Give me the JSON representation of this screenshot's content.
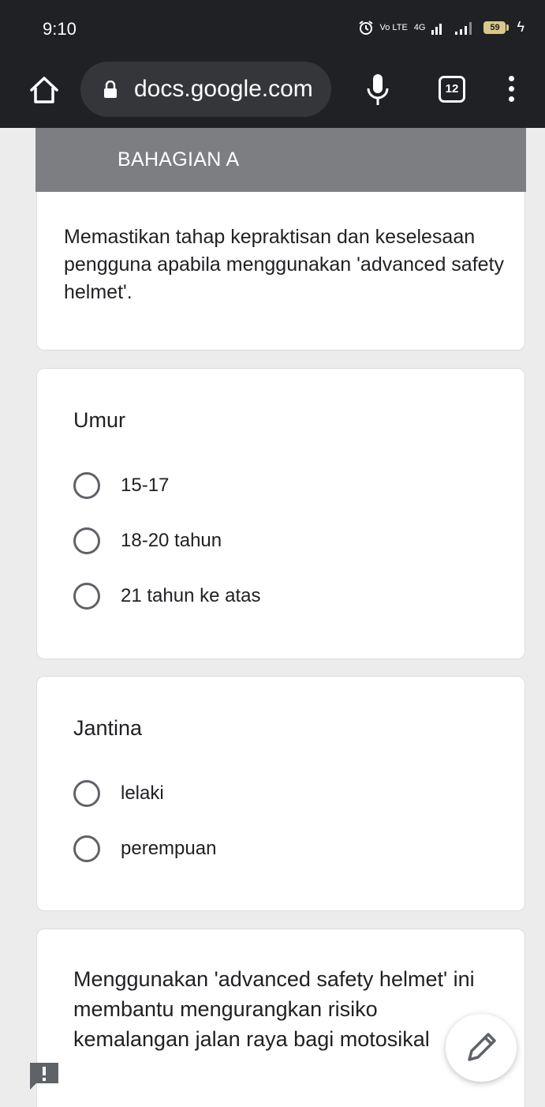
{
  "status_bar": {
    "time": "9:10",
    "network_volte": "Vo LTE",
    "network_4g": "4G",
    "battery_level": "59"
  },
  "browser": {
    "url": "docs.google.com",
    "tab_count": "12"
  },
  "form": {
    "section_title": "BAHAGIAN A",
    "section_description": "Memastikan tahap kepraktisan dan keselesaan pengguna apabila menggunakan 'advanced safety helmet'.",
    "questions": [
      {
        "title": "Umur",
        "options": [
          "15-17",
          "18-20 tahun",
          "21 tahun ke atas"
        ]
      },
      {
        "title": "Jantina",
        "options": [
          "lelaki",
          "perempuan"
        ]
      },
      {
        "title": "Menggunakan 'advanced safety helmet' ini membantu mengurangkan risiko kemalangan jalan raya bagi motosikal"
      }
    ]
  },
  "colors": {
    "browser_bar": "#202124",
    "section_header": "#7c7e82",
    "page_background": "#ececec",
    "radio_border": "#5f6368"
  },
  "icons": {
    "home": "home-icon",
    "lock": "lock-icon",
    "mic": "microphone-icon",
    "menu": "more-vert-icon",
    "edit": "pencil-icon",
    "feedback": "feedback-icon"
  }
}
